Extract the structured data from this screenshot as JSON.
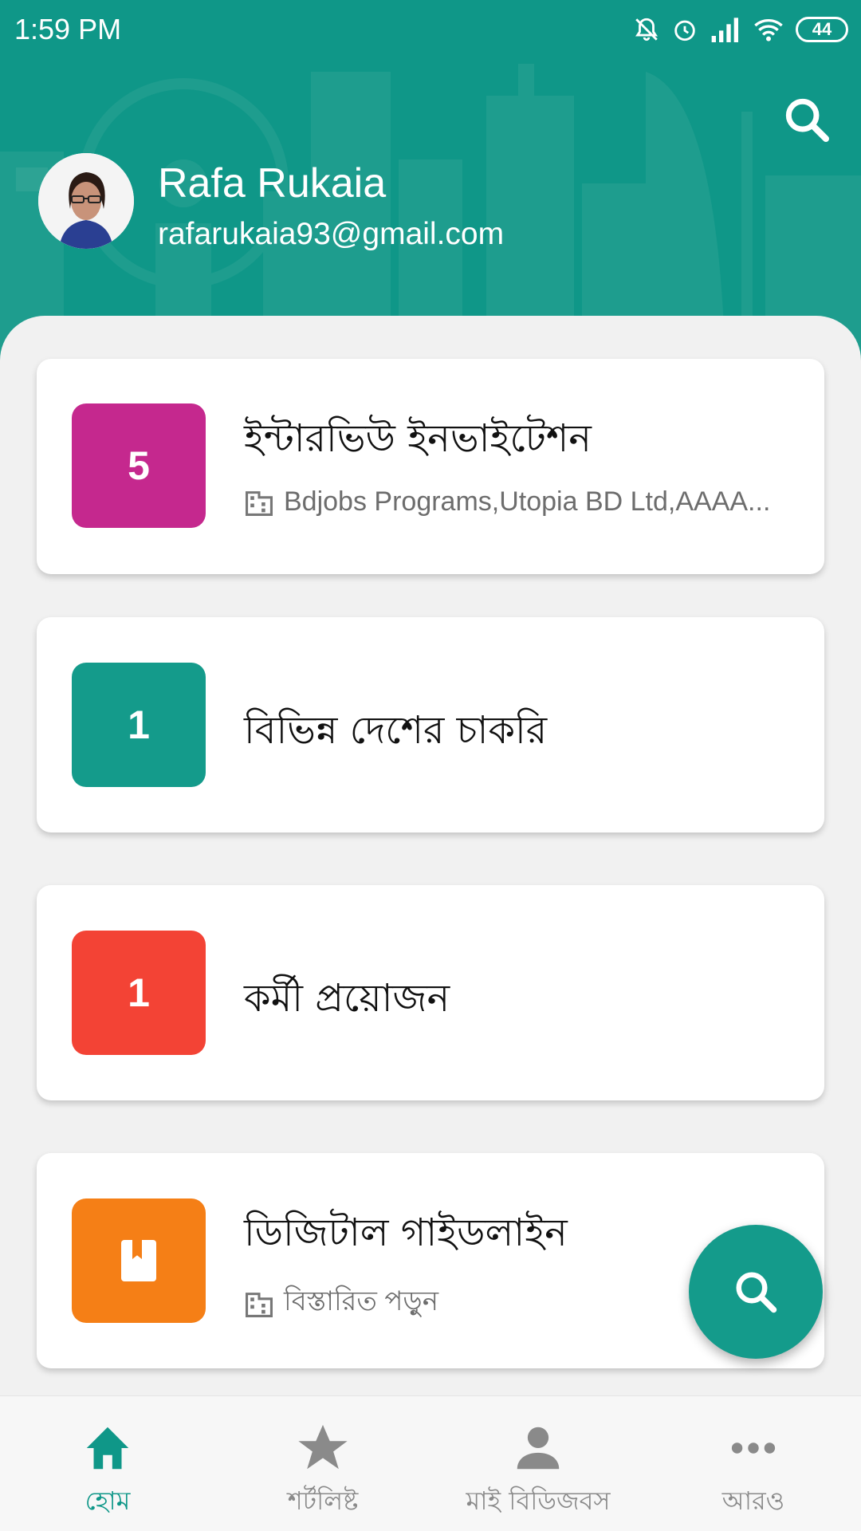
{
  "status_bar": {
    "time": "1:59  PM",
    "battery": "44",
    "icons": [
      "bell-off-icon",
      "alarm-icon",
      "signal-icon",
      "wifi-icon",
      "battery-icon"
    ]
  },
  "header": {
    "search_icon": "search-icon",
    "user_name": "Rafa Rukaia",
    "user_email": "rafarukaia93@gmail.com"
  },
  "cards": [
    {
      "badge": "5",
      "badge_color": "#c5288e",
      "title": "ইন্টারভিউ ইনভাইটেশন",
      "subtitle": "Bdjobs Programs,Utopia BD Ltd,AAAA..."
    },
    {
      "badge": "1",
      "badge_color": "#149b8b",
      "title": "বিভিন্ন দেশের চাকরি"
    },
    {
      "badge": "1",
      "badge_color": "#f34335",
      "title": "কর্মী প্রয়োজন"
    },
    {
      "badge_icon": "book-icon",
      "badge_color": "#f57f16",
      "title": "ডিজিটাল গাইডলাইন",
      "subtitle": "বিস্তারিত পড়ুন"
    }
  ],
  "bottom_nav": [
    {
      "label": "হোম",
      "icon": "home-icon",
      "active": true
    },
    {
      "label": "শর্টলিষ্ট",
      "icon": "star-icon"
    },
    {
      "label": "মাই বিডিজবস",
      "icon": "person-icon"
    },
    {
      "label": "আরও",
      "icon": "more-icon"
    }
  ],
  "colors": {
    "primary": "#0f9788",
    "active_nav": "#0f9788",
    "inactive_nav": "#8a8a8a"
  }
}
